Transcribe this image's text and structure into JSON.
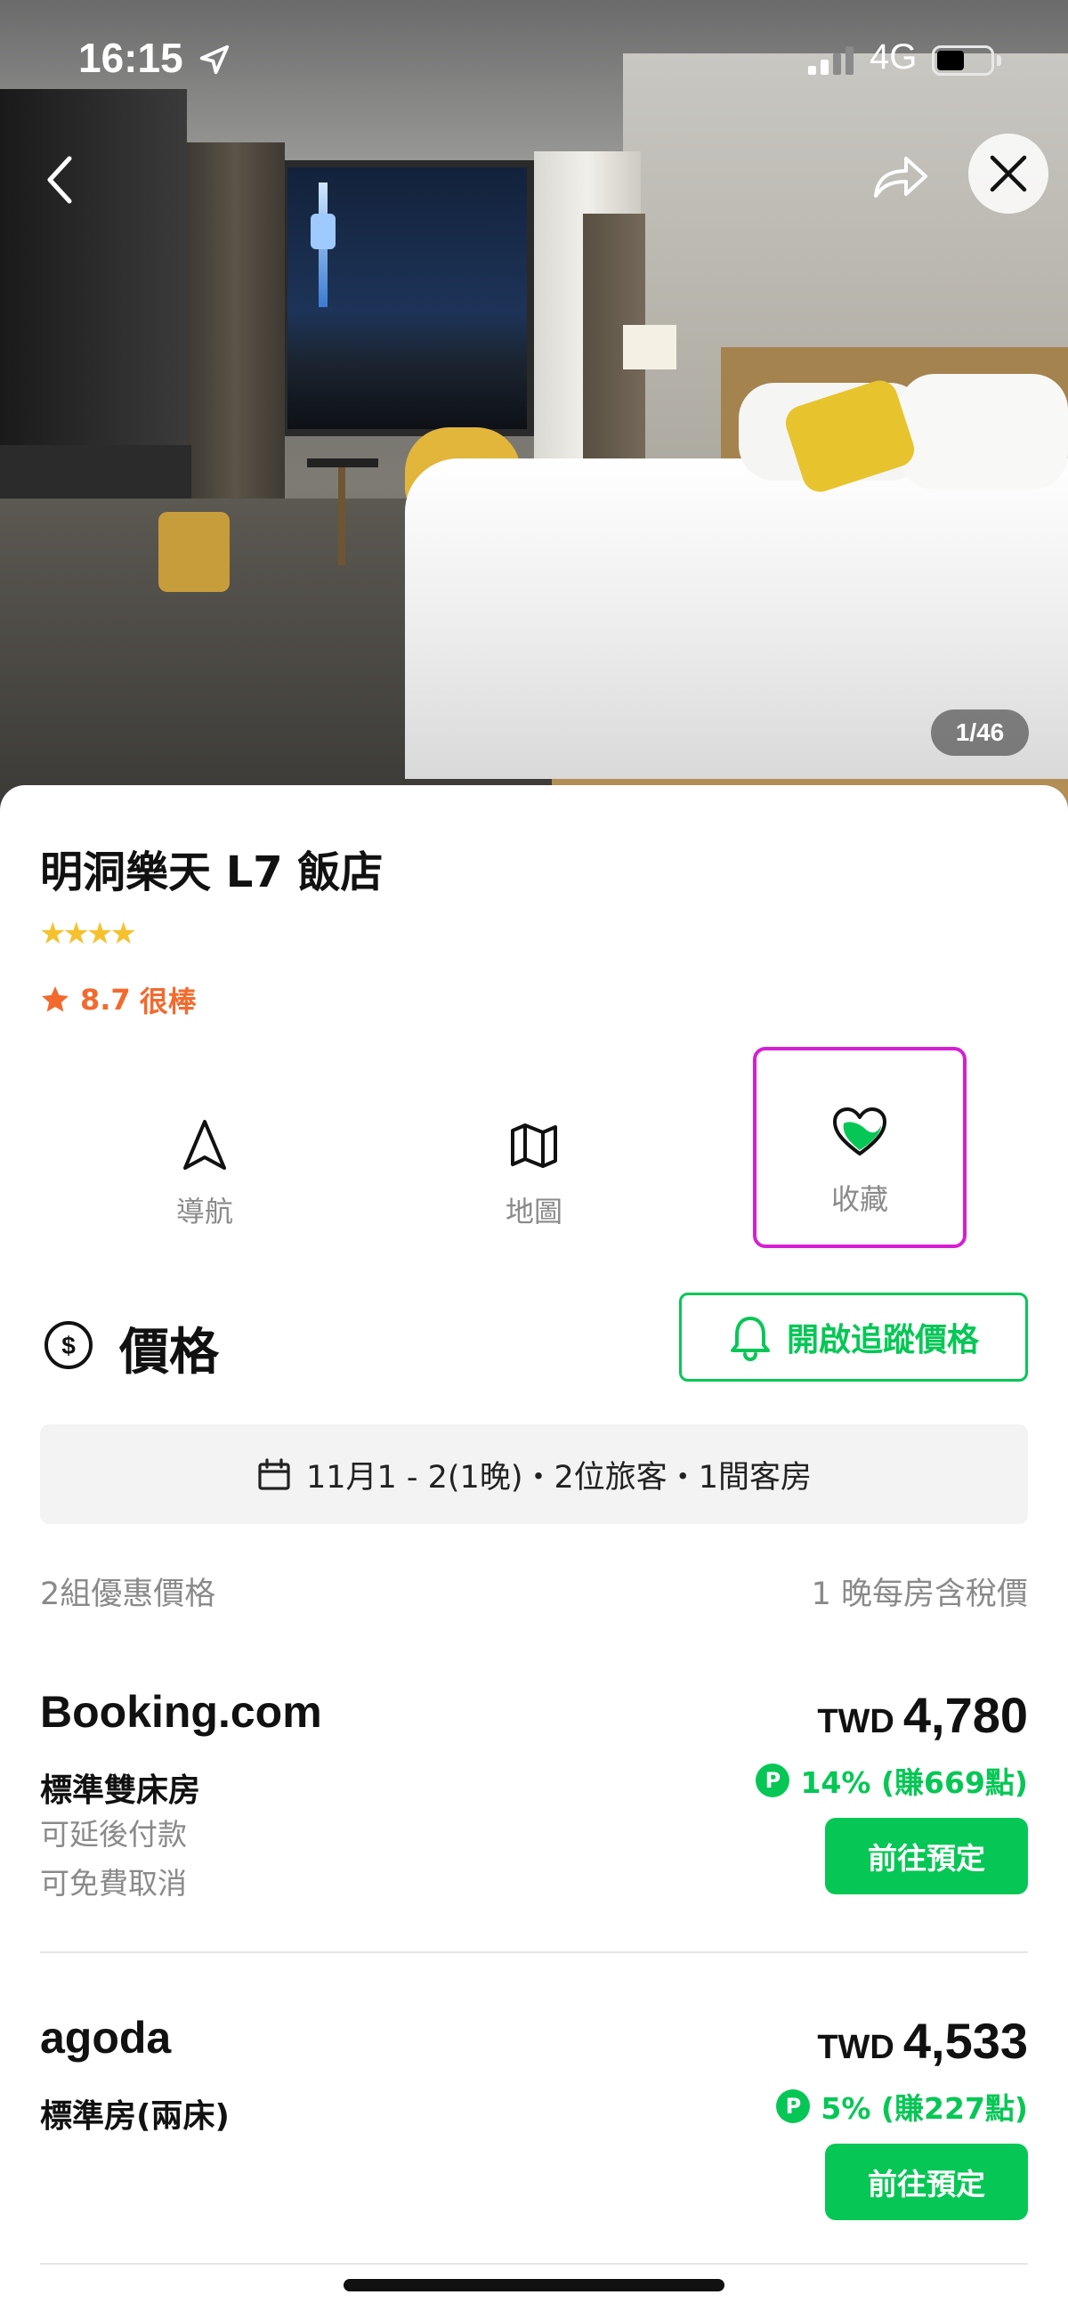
{
  "status_bar": {
    "time": "16:15",
    "network": "4G"
  },
  "gallery": {
    "counter": "1/46"
  },
  "hotel": {
    "name": "明洞樂天 L7 飯店",
    "star_count": 4,
    "rating_score": "8.7",
    "rating_text": "很棒"
  },
  "actions": [
    {
      "label": "導航",
      "icon": "navigation-arrow-icon"
    },
    {
      "label": "地圖",
      "icon": "map-icon"
    },
    {
      "label": "收藏",
      "icon": "heart-icon"
    }
  ],
  "price_section": {
    "title": "價格",
    "track_button": "開啟追蹤價格",
    "date_summary": "11月1 - 2(1晚)・2位旅客・1間客房",
    "offer_count": "2組優惠價格",
    "price_note": "1 晚每房含稅價"
  },
  "offers": [
    {
      "site": "Booking.com",
      "room": "標準雙床房",
      "notes": [
        "可延後付款",
        "可免費取消"
      ],
      "currency": "TWD",
      "amount": "4,780",
      "points": "14% (賺669點)",
      "book_label": "前往預定"
    },
    {
      "site": "agoda",
      "room": "標準房(兩床)",
      "notes": [],
      "currency": "TWD",
      "amount": "4,533",
      "points": "5% (賺227點)",
      "book_label": "前往預定"
    }
  ],
  "colors": {
    "accent_green": "#06c755",
    "rating_orange": "#f26a2e",
    "star_yellow": "#f6c12d",
    "highlight_magenta": "#d61fd3"
  }
}
